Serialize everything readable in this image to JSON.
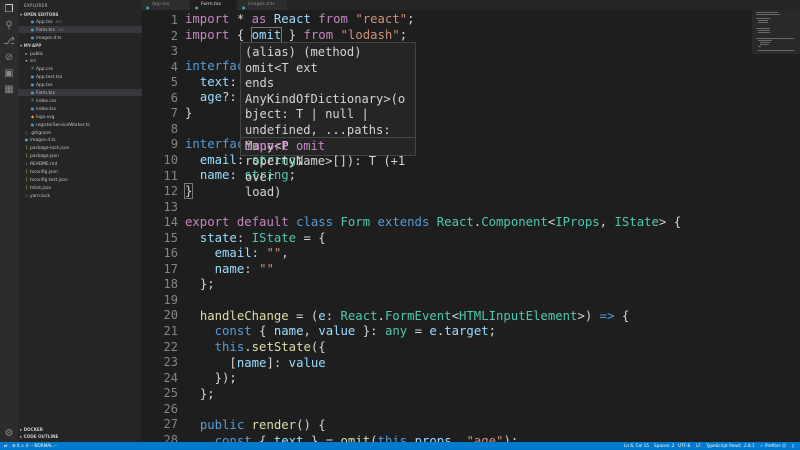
{
  "sidebar": {
    "title": "EXPLORER",
    "open_editors": {
      "label": "OPEN EDITORS",
      "items": [
        {
          "name": "App.tsx",
          "tag": "src"
        },
        {
          "name": "Form.tsx",
          "tag": "src"
        },
        {
          "name": "images.d.ts",
          "tag": ""
        }
      ]
    },
    "project": {
      "label": "MY-APP",
      "items": [
        {
          "name": "public",
          "kind": "folder",
          "indent": 1
        },
        {
          "name": "src",
          "kind": "folder",
          "indent": 1
        },
        {
          "name": "App.css",
          "kind": "css",
          "indent": 2
        },
        {
          "name": "App.test.tsx",
          "kind": "tsx",
          "indent": 2
        },
        {
          "name": "App.tsx",
          "kind": "tsx",
          "indent": 2
        },
        {
          "name": "Form.tsx",
          "kind": "tsx",
          "indent": 2,
          "selected": true
        },
        {
          "name": "index.css",
          "kind": "css",
          "indent": 2
        },
        {
          "name": "index.tsx",
          "kind": "tsx",
          "indent": 2
        },
        {
          "name": "logo.svg",
          "kind": "svg",
          "indent": 2
        },
        {
          "name": "registerServiceWorker.ts",
          "kind": "ts",
          "indent": 2
        },
        {
          "name": ".gitignore",
          "kind": "file",
          "indent": 1
        },
        {
          "name": "images.d.ts",
          "kind": "ts",
          "indent": 1
        },
        {
          "name": "package-lock.json",
          "kind": "json",
          "indent": 1
        },
        {
          "name": "package.json",
          "kind": "json",
          "indent": 1
        },
        {
          "name": "README.md",
          "kind": "md",
          "indent": 1
        },
        {
          "name": "tsconfig.json",
          "kind": "json",
          "indent": 1
        },
        {
          "name": "tsconfig.test.json",
          "kind": "json",
          "indent": 1
        },
        {
          "name": "tslint.json",
          "kind": "json",
          "indent": 1
        },
        {
          "name": "yarn.lock",
          "kind": "file",
          "indent": 1
        }
      ]
    },
    "bottom_sections": [
      "DOCKER",
      "CODE OUTLINE"
    ]
  },
  "tabs": [
    {
      "label": "App.tsx",
      "active": false
    },
    {
      "label": "Form.tsx",
      "active": true
    },
    {
      "label": "images.d.ts",
      "active": false
    }
  ],
  "editor": {
    "lines": [
      {
        "n": 1
      },
      {
        "n": 2
      },
      {
        "n": 3
      },
      {
        "n": 4
      },
      {
        "n": 5
      },
      {
        "n": 6
      },
      {
        "n": 7
      },
      {
        "n": 8
      },
      {
        "n": 9
      },
      {
        "n": 10
      },
      {
        "n": 11
      },
      {
        "n": 12
      },
      {
        "n": 13
      },
      {
        "n": 14
      },
      {
        "n": 15
      },
      {
        "n": 16
      },
      {
        "n": 17
      },
      {
        "n": 18
      },
      {
        "n": 19
      },
      {
        "n": 20
      },
      {
        "n": 21
      },
      {
        "n": 22
      },
      {
        "n": 23
      },
      {
        "n": 24
      },
      {
        "n": 25
      },
      {
        "n": 26
      },
      {
        "n": 27
      },
      {
        "n": 28
      }
    ],
    "tokens": {
      "l1": [
        "import",
        " * ",
        "as",
        " React ",
        "from",
        " ",
        "\"react\"",
        ";"
      ],
      "l2": [
        "import",
        " { ",
        "omit",
        " } ",
        "from",
        " ",
        "\"lodash\"",
        ";"
      ],
      "l4": [
        "interface"
      ],
      "l5": [
        "text",
        ": s"
      ],
      "l6": [
        "age",
        "?: n"
      ],
      "l7": [
        "}"
      ],
      "l9": [
        "interface"
      ],
      "l10": [
        "email",
        ": ",
        "string",
        ";"
      ],
      "l11": [
        "name",
        ": ",
        "string",
        ";"
      ],
      "l12": [
        "}"
      ],
      "l14": [
        "export",
        " ",
        "default",
        " ",
        "class",
        " ",
        "Form",
        " ",
        "extends",
        " ",
        "React",
        ".",
        "Component",
        "<",
        "IProps",
        ", ",
        "IState",
        "> {"
      ],
      "l15": [
        "state",
        ": ",
        "IState",
        " = {"
      ],
      "l16": [
        "email",
        ": ",
        "\"\"",
        ","
      ],
      "l17": [
        "name",
        ": ",
        "\"\""
      ],
      "l18": [
        "};"
      ],
      "l20": [
        "handleChange",
        " = (",
        "e",
        ": ",
        "React",
        ".",
        "FormEvent",
        "<",
        "HTMLInputElement",
        ">) ",
        "=>",
        " {"
      ],
      "l21": [
        "const",
        " { ",
        "name",
        ", ",
        "value",
        " }: ",
        "any",
        " = ",
        "e",
        ".",
        "target",
        ";"
      ],
      "l22": [
        "this",
        ".",
        "setState",
        "({"
      ],
      "l23": [
        "[",
        "name",
        "]: ",
        "value"
      ],
      "l24": [
        "});"
      ],
      "l25": [
        "};"
      ],
      "l27": [
        "public",
        " ",
        "render",
        "() {"
      ],
      "l28": [
        "const",
        " { ",
        "text",
        " } = ",
        "omit",
        "(",
        "this",
        ".",
        "props",
        ", ",
        "\"age\"",
        ");"
      ]
    }
  },
  "hover": {
    "lines": [
      "(alias) (method) omit<T ext",
      "ends AnyKindOfDictionary>(o",
      "bject: T | null |",
      "undefined, ...paths: Many<P",
      "ropertyName>[]): T (+1 over",
      "load)"
    ],
    "import_line": "import omit"
  },
  "statusbar": {
    "mode": "-- NORMAL --",
    "position": "Ln 6, Col 15",
    "spaces": "Spaces: 2",
    "encoding": "UTF-8",
    "eol": "LF",
    "language": "TypeScript React",
    "version": "2.8.1",
    "formatter": "Prettier"
  },
  "colors": {
    "accent": "#007acc",
    "editor_bg": "#1e1e1e",
    "keyword": "#569cd6",
    "string": "#ce9178",
    "type": "#4ec9b0"
  }
}
